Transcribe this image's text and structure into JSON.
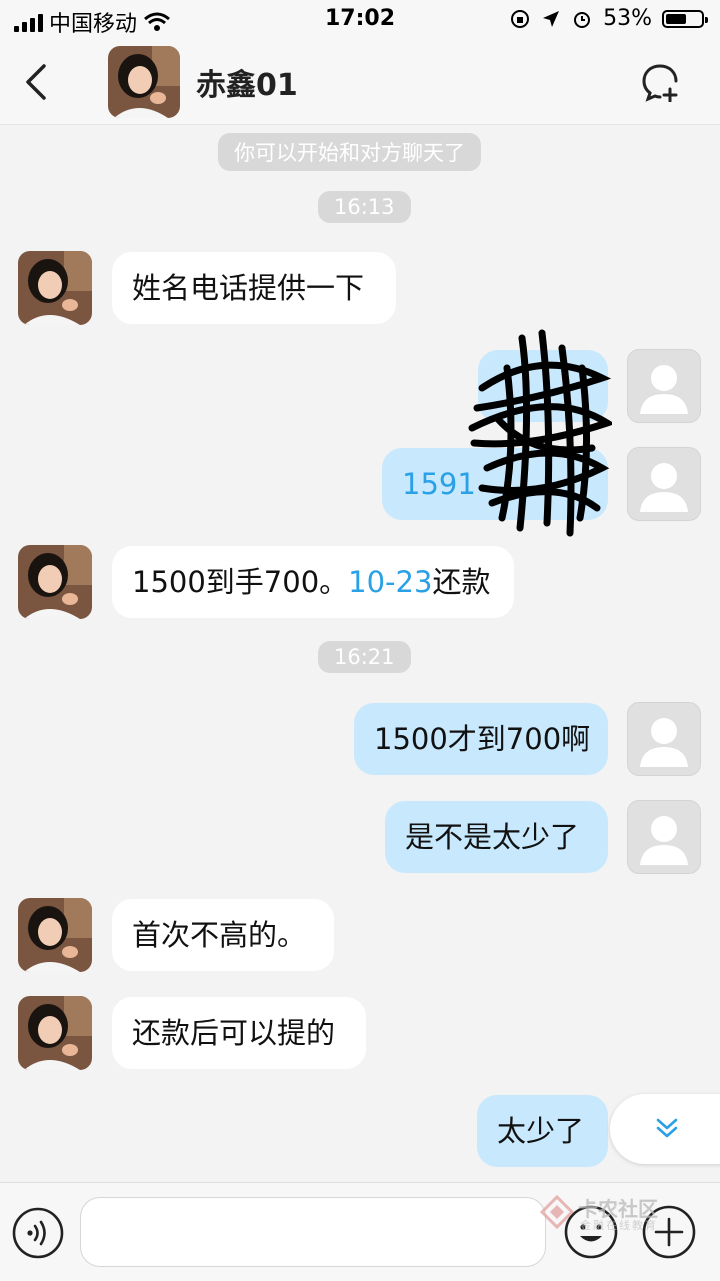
{
  "status_bar": {
    "carrier": "中国移动",
    "time": "17:02",
    "battery": "53%"
  },
  "header": {
    "title": "赤鑫01",
    "back_icon": "chevron-left-icon",
    "action_icon": "chat-add-icon"
  },
  "chat": {
    "system_notice": "你可以开始和对方聊天了",
    "time_stamps": [
      "16:13",
      "16:21"
    ],
    "messages": [
      {
        "side": "in",
        "text": "姓名电话提供一下"
      },
      {
        "side": "out",
        "text": "",
        "redacted": true
      },
      {
        "side": "out",
        "text": "1591",
        "link": true,
        "redacted": true
      },
      {
        "side": "in",
        "text_a": "1500到手700。",
        "link_text": "10-23",
        "text_b": "还款"
      },
      {
        "side": "out",
        "text": "1500才到700啊"
      },
      {
        "side": "out",
        "text": "是不是太少了"
      },
      {
        "side": "in",
        "text": "首次不高的。"
      },
      {
        "side": "in",
        "text": "还款后可以提的"
      },
      {
        "side": "out",
        "text": "太少了"
      }
    ]
  },
  "input_bar": {
    "voice_icon": "voice-icon",
    "emoji_icon": "emoji-icon",
    "plus_icon": "plus-icon"
  },
  "watermark": {
    "name": "卡农社区",
    "subtitle": "金融在线教育"
  },
  "colors": {
    "incoming_bubble": "#ffffff",
    "outgoing_bubble": "#c8e8fd",
    "link": "#2aa0e6",
    "background": "#f3f3f3"
  }
}
